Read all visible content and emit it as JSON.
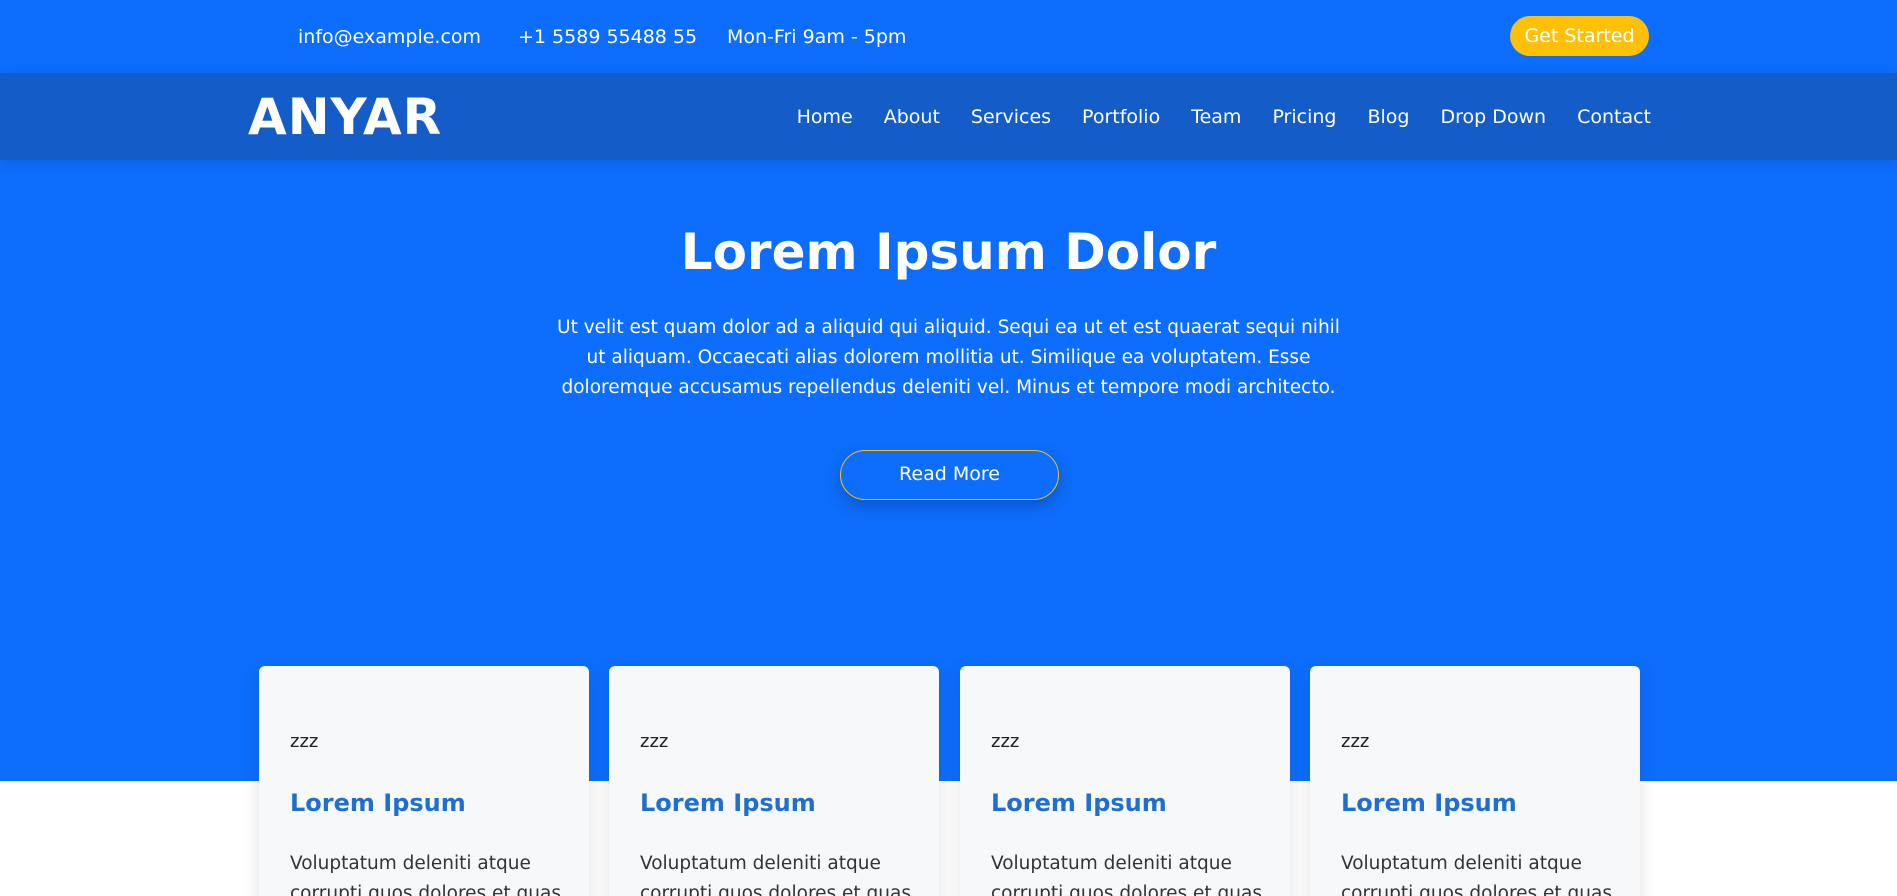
{
  "topbar": {
    "email": "info@example.com",
    "phone": "+1 5589 55488 55",
    "hours": "Mon-Fri 9am - 5pm",
    "cta_label": "Get Started"
  },
  "header": {
    "logo": "ANYAR",
    "nav": [
      "Home",
      "About",
      "Services",
      "Portfolio",
      "Team",
      "Pricing",
      "Blog",
      "Drop Down",
      "Contact"
    ]
  },
  "hero": {
    "title": "Lorem Ipsum Dolor",
    "text": "Ut velit est quam dolor ad a aliquid qui aliquid. Sequi ea ut et est quaerat sequi nihil ut aliquam. Occaecati alias dolorem mollitia ut. Similique ea voluptatem. Esse doloremque accusamus repellendus deleniti vel. Minus et tempore modi architecto.",
    "button_label": "Read More"
  },
  "cards": [
    {
      "icon_text": "zzz",
      "title": "Lorem Ipsum",
      "text": "Voluptatum deleniti atque corrupti quos dolores et quas"
    },
    {
      "icon_text": "zzz",
      "title": "Lorem Ipsum",
      "text": "Voluptatum deleniti atque corrupti quos dolores et quas"
    },
    {
      "icon_text": "zzz",
      "title": "Lorem Ipsum",
      "text": "Voluptatum deleniti atque corrupti quos dolores et quas"
    },
    {
      "icon_text": "zzz",
      "title": "Lorem Ipsum",
      "text": "Voluptatum deleniti atque corrupti quos dolores et quas"
    }
  ],
  "colors": {
    "primary": "#0d6efd",
    "header": "#145dc9",
    "accent": "#ffc107",
    "card_title": "#1f6fd1"
  }
}
